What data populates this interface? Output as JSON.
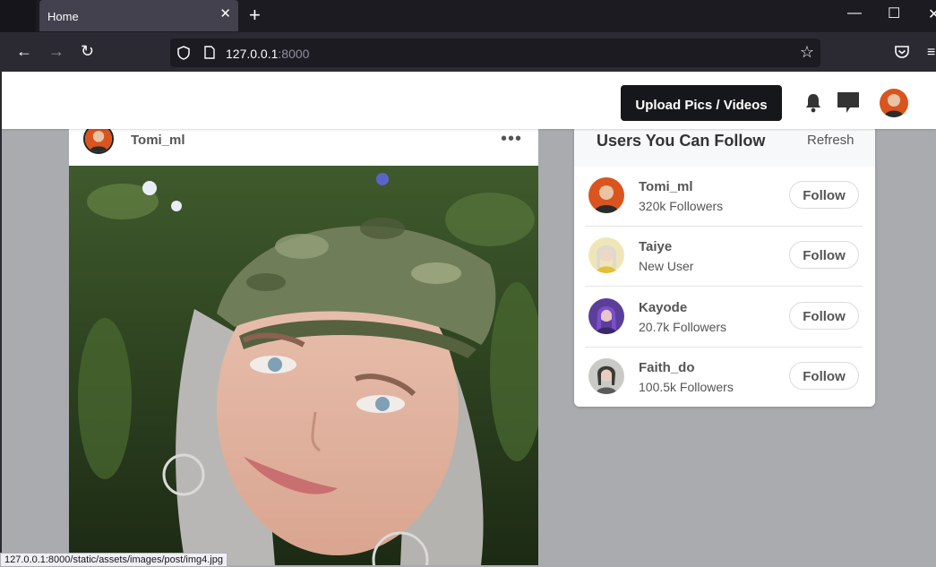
{
  "browser": {
    "tab_title": "Home",
    "url_host": "127.0.0.1",
    "url_port": ":8000",
    "status_url": "127.0.0.1:8000/static/assets/images/post/img4.jpg"
  },
  "header": {
    "upload_label": "Upload Pics / Videos"
  },
  "post": {
    "username": "Tomi_ml",
    "more_label": "•••"
  },
  "suggestions": {
    "title": "Users You Can Follow",
    "refresh_label": "Refresh",
    "follow_label": "Follow",
    "users": [
      {
        "name": "Tomi_ml",
        "sub": "320k Followers"
      },
      {
        "name": "Taiye",
        "sub": "New User"
      },
      {
        "name": "Kayode",
        "sub": "20.7k Followers"
      },
      {
        "name": "Faith_do",
        "sub": "100.5k Followers"
      }
    ]
  },
  "icons": {
    "bell": "bell-icon",
    "messages": "message-icon",
    "shield": "shield-icon",
    "star": "star-icon"
  },
  "colors": {
    "upload_bg": "#16171a",
    "page_bg": "#a9abae",
    "browser_bar": "#2b2a33"
  }
}
